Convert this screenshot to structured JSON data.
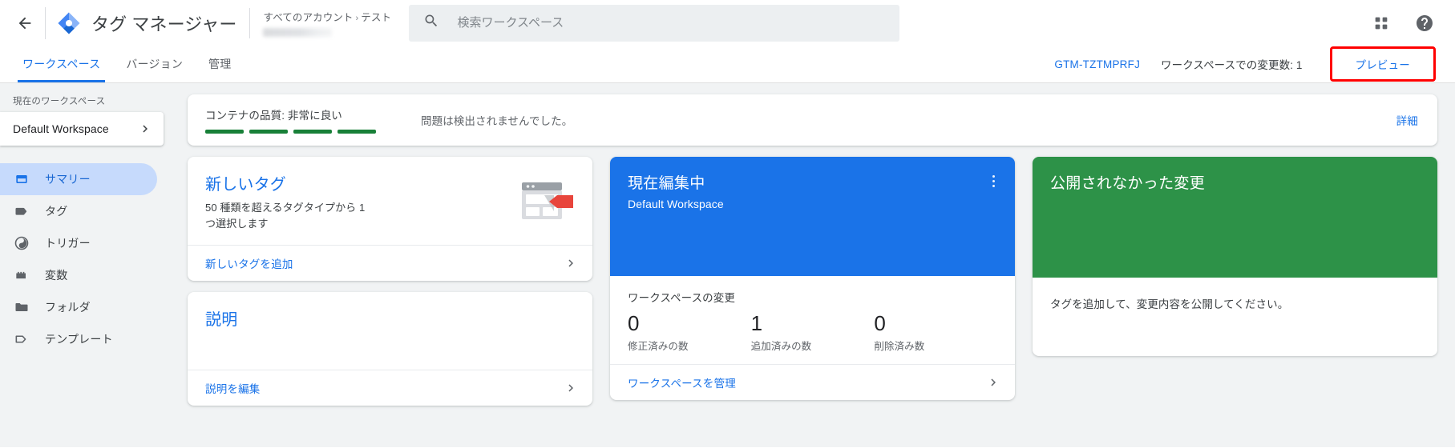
{
  "topbar": {
    "back_icon": "back-arrow-icon",
    "logo_icon": "tag-manager-logo-icon",
    "product_title": "タグ マネージャー",
    "breadcrumb": {
      "root": "すべてのアカウント",
      "separator": "›",
      "current": "テスト"
    },
    "search": {
      "icon": "search-icon",
      "placeholder": "検索ワークスペース",
      "value": ""
    },
    "apps_icon": "apps-grid-icon",
    "help_icon": "help-circle-icon"
  },
  "tabs": [
    {
      "label": "ワークスペース",
      "active": true
    },
    {
      "label": "バージョン",
      "active": false
    },
    {
      "label": "管理",
      "active": false
    }
  ],
  "tabbar_right": {
    "container_id": "GTM-TZTMPRFJ",
    "changes_label": "ワークスペースでの変更数: 1",
    "preview_label": "プレビュー",
    "highlight_color": "#ff0000"
  },
  "sidebar": {
    "section_label": "現在のワークスペース",
    "workspace_selector": {
      "name": "Default Workspace",
      "chevron_icon": "chevron-right-icon"
    },
    "items": [
      {
        "label": "サマリー",
        "icon": "summary-icon",
        "active": true
      },
      {
        "label": "タグ",
        "icon": "tag-icon",
        "active": false
      },
      {
        "label": "トリガー",
        "icon": "trigger-icon",
        "active": false
      },
      {
        "label": "変数",
        "icon": "variable-icon",
        "active": false
      },
      {
        "label": "フォルダ",
        "icon": "folder-icon",
        "active": false
      },
      {
        "label": "テンプレート",
        "icon": "template-icon",
        "active": false
      }
    ]
  },
  "quality": {
    "title": "コンテナの品質: 非常に良い",
    "message": "問題は検出されませんでした。",
    "details_link": "詳細",
    "bar_count": 4,
    "bar_color": "#188038"
  },
  "new_tag_card": {
    "title": "新しいタグ",
    "subtitle": "50 種類を超えるタグタイプから 1 つ選択します",
    "illustration_icon": "browser-tag-illustration-icon",
    "footer_link": "新しいタグを追加",
    "footer_chevron_icon": "chevron-right-icon"
  },
  "description_card": {
    "title": "説明",
    "footer_link": "説明を編集",
    "footer_chevron_icon": "chevron-right-icon"
  },
  "workspace_card": {
    "hero_title": "現在編集中",
    "hero_subtitle": "Default Workspace",
    "menu_icon": "kebab-menu-icon",
    "accent_color": "#1a73e8",
    "stats_title": "ワークスペースの変更",
    "stats": [
      {
        "value": "0",
        "label": "修正済みの数"
      },
      {
        "value": "1",
        "label": "追加済みの数"
      },
      {
        "value": "0",
        "label": "削除済み数"
      }
    ],
    "footer_link": "ワークスペースを管理",
    "footer_chevron_icon": "chevron-right-icon"
  },
  "published_card": {
    "hero_title": "公開されなかった変更",
    "accent_color": "#2d9248",
    "body_text": "タグを追加して、変更内容を公開してください。"
  }
}
